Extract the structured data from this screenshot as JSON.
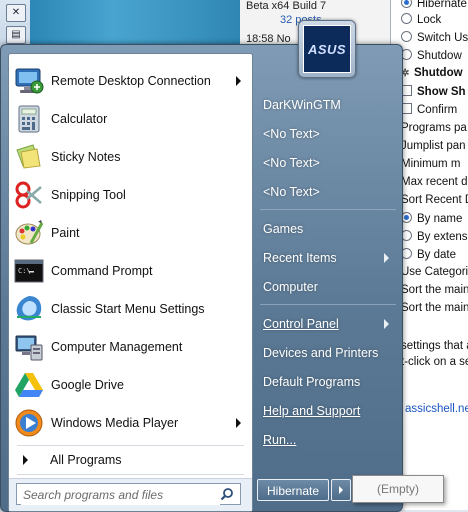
{
  "background": {
    "forum": {
      "post_title": "Beta x64 Build 7",
      "post_count": "32 posts",
      "post_date": "18:58 No"
    },
    "settings": {
      "opt_hibernate": "Hibernate",
      "opt_lock": "Lock",
      "opt_switch": "Switch Us",
      "opt_shutdown": "Shutdow",
      "opt_shutdown_bold": "Shutdow",
      "opt_show": "Show Sh",
      "opt_confirm": "Confirm",
      "p_programs": "Programs pa",
      "p_jumplist": "Jumplist pan",
      "p_minimum": "Minimum m",
      "p_maxrecent": "Max recent d",
      "p_sortrecent": "Sort Recent D",
      "r_byname": "By name",
      "r_byext": "By extens",
      "r_bydate": "By date",
      "p_usecat": "Use Categori",
      "p_sortmain1": "Sort the main",
      "p_sortmain2": "Sort the main",
      "p_settings": "settings that a",
      "p_rightclick": "t-click on a se",
      "p_link": "assicshell.net"
    }
  },
  "start_menu": {
    "programs": [
      {
        "label": "Remote Desktop Connection",
        "icon": "remote-desktop-icon",
        "has_submenu": true
      },
      {
        "label": "Calculator",
        "icon": "calculator-icon",
        "has_submenu": false
      },
      {
        "label": "Sticky Notes",
        "icon": "sticky-notes-icon",
        "has_submenu": false
      },
      {
        "label": "Snipping Tool",
        "icon": "snipping-tool-icon",
        "has_submenu": false
      },
      {
        "label": "Paint",
        "icon": "paint-icon",
        "has_submenu": false
      },
      {
        "label": "Command Prompt",
        "icon": "command-prompt-icon",
        "has_submenu": false
      },
      {
        "label": "Classic Start Menu Settings",
        "icon": "classic-shell-icon",
        "has_submenu": false
      },
      {
        "label": "Computer Management",
        "icon": "computer-management-icon",
        "has_submenu": false
      },
      {
        "label": "Google Drive",
        "icon": "google-drive-icon",
        "has_submenu": false
      },
      {
        "label": "Windows Media Player",
        "icon": "media-player-icon",
        "has_submenu": true
      }
    ],
    "all_programs": "All Programs",
    "search_placeholder": "Search programs and files",
    "user": {
      "avatar_text": "ASUS"
    },
    "right_items": {
      "username": "DarKWinGTM",
      "notext1": "<No Text>",
      "notext2": "<No Text>",
      "notext3": "<No Text>",
      "games": "Games",
      "recent": "Recent Items",
      "computer": "Computer",
      "control_panel": "Control Panel",
      "devices": "Devices and Printers",
      "default_programs": "Default Programs",
      "help": "Help and Support",
      "run": "Run..."
    },
    "shutdown_button": "Hibernate",
    "popup_text": "(Empty)"
  }
}
